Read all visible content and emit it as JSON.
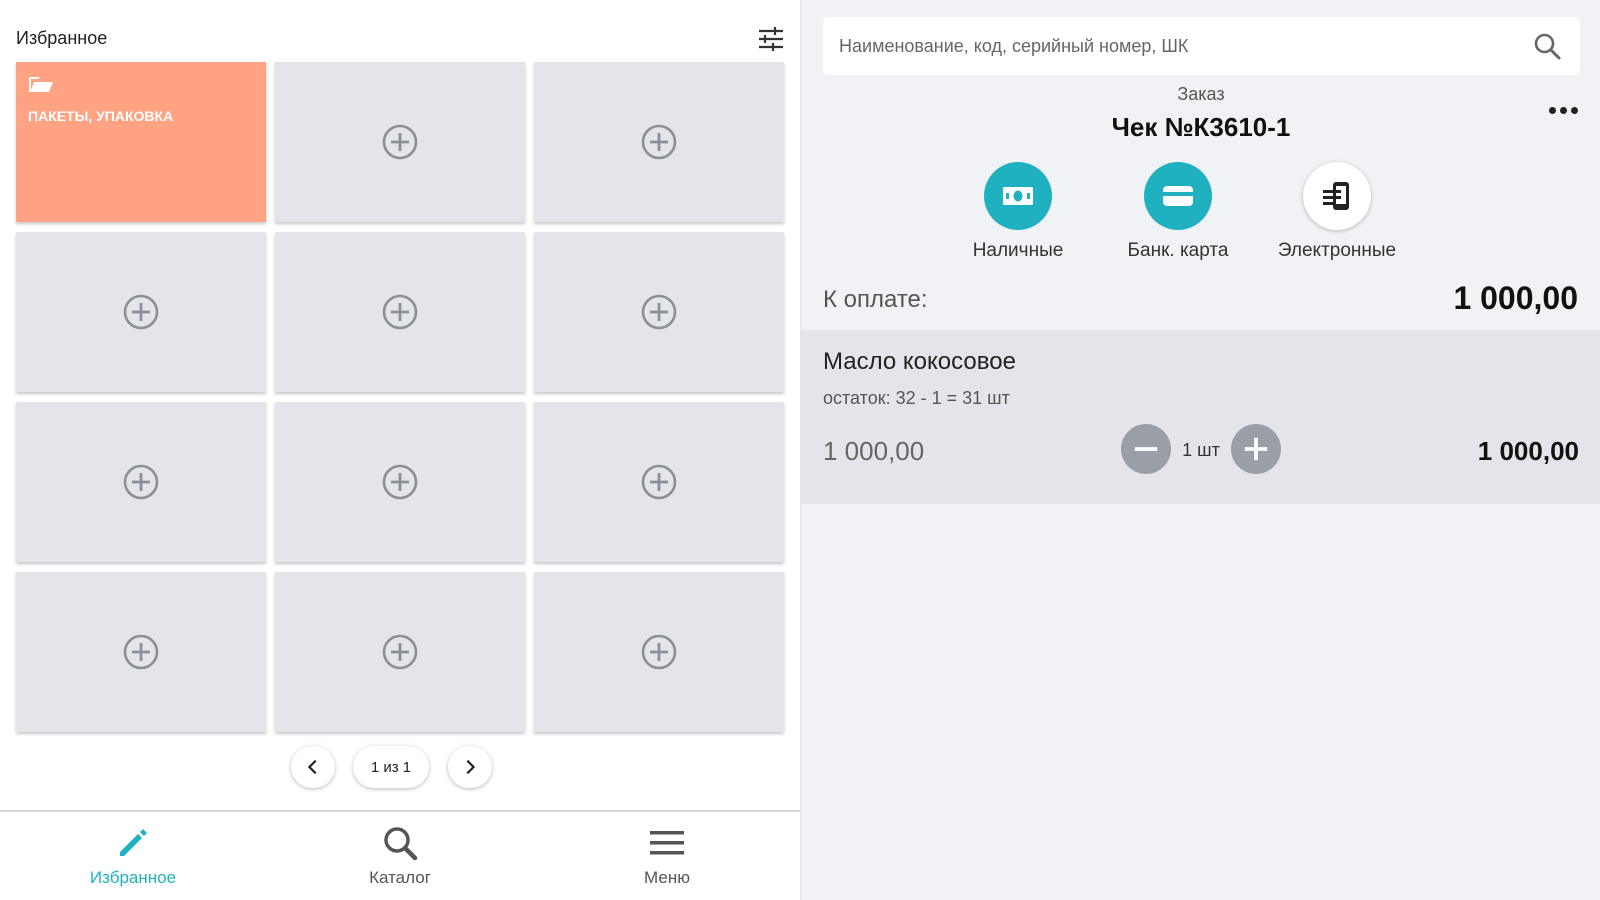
{
  "favorites": {
    "title": "Избранное",
    "tiles": [
      {
        "type": "folder",
        "label": "ПАКЕТЫ, УПАКОВКА"
      },
      {
        "type": "empty"
      },
      {
        "type": "empty"
      },
      {
        "type": "empty"
      },
      {
        "type": "empty"
      },
      {
        "type": "empty"
      },
      {
        "type": "empty"
      },
      {
        "type": "empty"
      },
      {
        "type": "empty"
      },
      {
        "type": "empty"
      },
      {
        "type": "empty"
      },
      {
        "type": "empty"
      }
    ]
  },
  "pager": {
    "label": "1 из 1"
  },
  "nav": {
    "items": [
      {
        "label": "Избранное",
        "icon": "pencil-icon",
        "active": true
      },
      {
        "label": "Каталог",
        "icon": "search-icon",
        "active": false
      },
      {
        "label": "Меню",
        "icon": "menu-icon",
        "active": false
      }
    ]
  },
  "search": {
    "placeholder": "Наименование, код, серийный номер, ШК"
  },
  "order": {
    "label": "Заказ",
    "check_title": "Чек №К3610-1",
    "payments": [
      {
        "label": "Наличные",
        "icon": "cash-icon"
      },
      {
        "label": "Банк. карта",
        "icon": "card-icon"
      },
      {
        "label": "Электронные",
        "icon": "electronic-payment-icon"
      }
    ],
    "to_pay_label": "К оплате:",
    "to_pay_value": "1 000,00"
  },
  "item": {
    "name": "Масло кокосовое",
    "stock": "остаток: 32 - 1 = 31 шт",
    "price": "1 000,00",
    "quantity": "1 шт",
    "total": "1 000,00"
  },
  "colors": {
    "accent": "#1fb1c0",
    "folder": "#ffa383",
    "tile": "#e3e5ea"
  }
}
